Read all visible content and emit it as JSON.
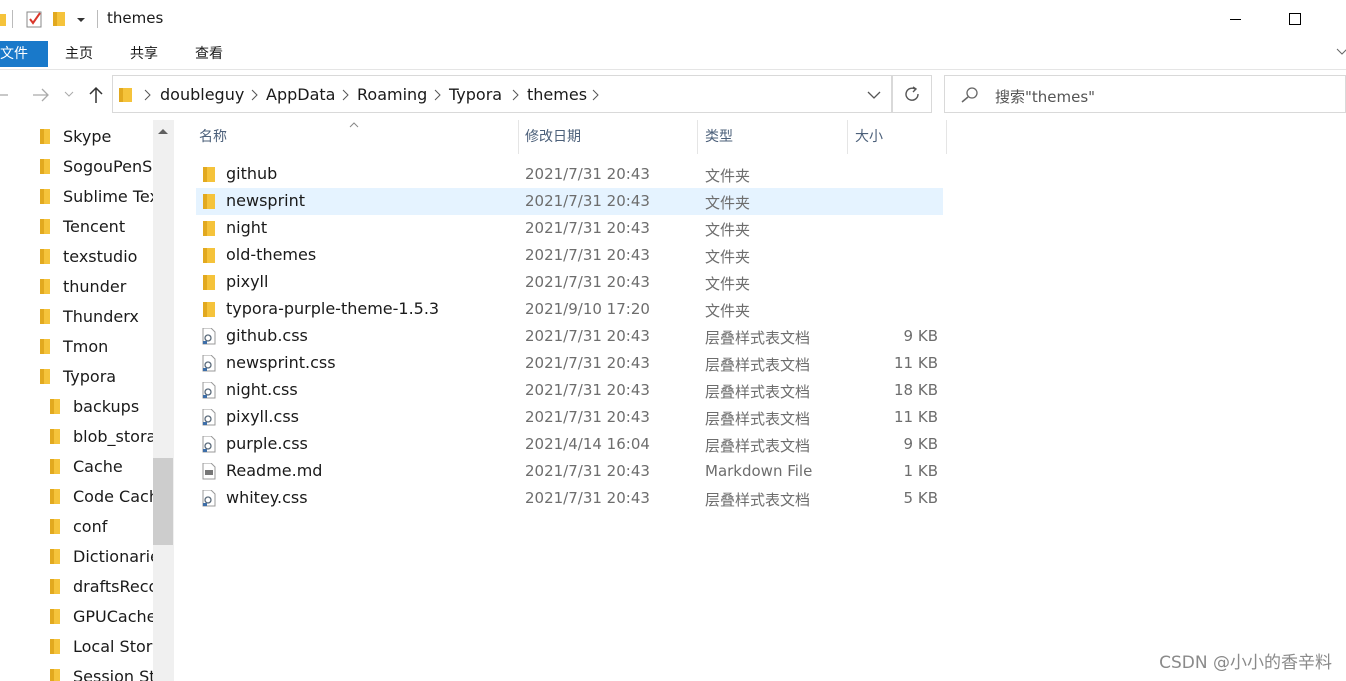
{
  "window": {
    "title": "themes"
  },
  "ribbon": {
    "tabs": [
      "文件",
      "主页",
      "共享",
      "查看"
    ]
  },
  "address": {
    "crumbs": [
      "doubleguy",
      "AppData",
      "Roaming",
      "Typora",
      "themes"
    ]
  },
  "search": {
    "placeholder": "搜索\"themes\""
  },
  "nav": {
    "items": [
      {
        "label": "Skype",
        "level": 0
      },
      {
        "label": "SogouPenSg",
        "level": 0
      },
      {
        "label": "Sublime Tex",
        "level": 0
      },
      {
        "label": "Tencent",
        "level": 0
      },
      {
        "label": "texstudio",
        "level": 0
      },
      {
        "label": "thunder",
        "level": 0
      },
      {
        "label": "Thunderx",
        "level": 0
      },
      {
        "label": "Tmon",
        "level": 0
      },
      {
        "label": "Typora",
        "level": 0
      },
      {
        "label": "backups",
        "level": 1
      },
      {
        "label": "blob_stora",
        "level": 1
      },
      {
        "label": "Cache",
        "level": 1
      },
      {
        "label": "Code Cach",
        "level": 1
      },
      {
        "label": "conf",
        "level": 1
      },
      {
        "label": "Dictionarie",
        "level": 1
      },
      {
        "label": "draftsReco",
        "level": 1
      },
      {
        "label": "GPUCache",
        "level": 1
      },
      {
        "label": "Local Stora",
        "level": 1
      },
      {
        "label": "Session Sto",
        "level": 1
      }
    ]
  },
  "columns": {
    "name": "名称",
    "date": "修改日期",
    "type": "类型",
    "size": "大小"
  },
  "files": [
    {
      "name": "github",
      "date": "2021/7/31 20:43",
      "type": "文件夹",
      "size": "",
      "icon": "folder",
      "selected": false
    },
    {
      "name": "newsprint",
      "date": "2021/7/31 20:43",
      "type": "文件夹",
      "size": "",
      "icon": "folder",
      "selected": true
    },
    {
      "name": "night",
      "date": "2021/7/31 20:43",
      "type": "文件夹",
      "size": "",
      "icon": "folder",
      "selected": false
    },
    {
      "name": "old-themes",
      "date": "2021/7/31 20:43",
      "type": "文件夹",
      "size": "",
      "icon": "folder",
      "selected": false
    },
    {
      "name": "pixyll",
      "date": "2021/7/31 20:43",
      "type": "文件夹",
      "size": "",
      "icon": "folder",
      "selected": false
    },
    {
      "name": "typora-purple-theme-1.5.3",
      "date": "2021/9/10 17:20",
      "type": "文件夹",
      "size": "",
      "icon": "folder",
      "selected": false
    },
    {
      "name": "github.css",
      "date": "2021/7/31 20:43",
      "type": "层叠样式表文档",
      "size": "9 KB",
      "icon": "css-file",
      "selected": false
    },
    {
      "name": "newsprint.css",
      "date": "2021/7/31 20:43",
      "type": "层叠样式表文档",
      "size": "11 KB",
      "icon": "css-file",
      "selected": false
    },
    {
      "name": "night.css",
      "date": "2021/7/31 20:43",
      "type": "层叠样式表文档",
      "size": "18 KB",
      "icon": "css-file",
      "selected": false
    },
    {
      "name": "pixyll.css",
      "date": "2021/7/31 20:43",
      "type": "层叠样式表文档",
      "size": "11 KB",
      "icon": "css-file",
      "selected": false
    },
    {
      "name": "purple.css",
      "date": "2021/4/14 16:04",
      "type": "层叠样式表文档",
      "size": "9 KB",
      "icon": "css-file",
      "selected": false
    },
    {
      "name": "Readme.md",
      "date": "2021/7/31 20:43",
      "type": "Markdown File",
      "size": "1 KB",
      "icon": "md-file",
      "selected": false
    },
    {
      "name": "whitey.css",
      "date": "2021/7/31 20:43",
      "type": "层叠样式表文档",
      "size": "5 KB",
      "icon": "css-file",
      "selected": false
    }
  ],
  "watermark": "CSDN @小小的香辛料",
  "colors": {
    "folder": "#f5c33b",
    "accent": "#1979ca",
    "selection": "#e5f3ff"
  }
}
